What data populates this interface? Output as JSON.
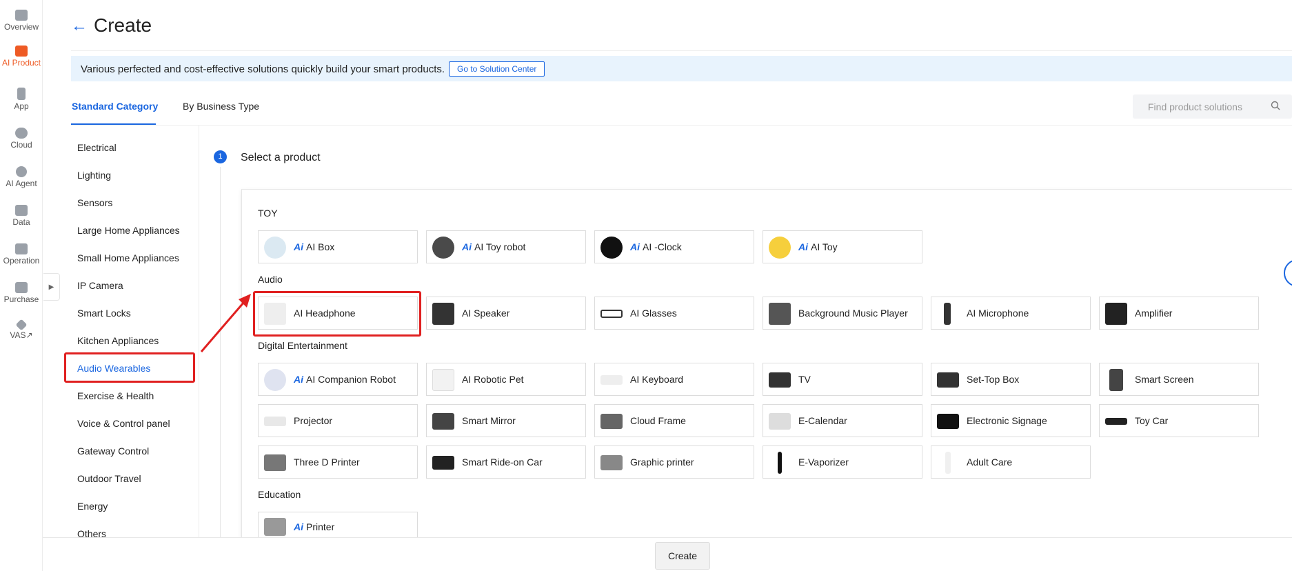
{
  "rail": [
    {
      "label": "Overview"
    },
    {
      "label": "AI Product",
      "active": true
    },
    {
      "label": "App"
    },
    {
      "label": "Cloud"
    },
    {
      "label": "AI Agent"
    },
    {
      "label": "Data"
    },
    {
      "label": "Operation"
    },
    {
      "label": "Purchase"
    },
    {
      "label": "VAS↗"
    }
  ],
  "header": {
    "back_icon": "←",
    "title": "Create"
  },
  "banner": {
    "text": "Various perfected and cost-effective solutions quickly build your smart products.",
    "button": "Go to Solution Center"
  },
  "tabs": [
    {
      "label": "Standard Category",
      "active": true
    },
    {
      "label": "By Business Type"
    }
  ],
  "search": {
    "placeholder": "Find product solutions",
    "icon": "search-icon"
  },
  "categories": [
    "Electrical",
    "Lighting",
    "Sensors",
    "Large Home Appliances",
    "Small Home Appliances",
    "IP Camera",
    "Smart Locks",
    "Kitchen Appliances",
    "Audio Wearables",
    "Exercise & Health",
    "Voice & Control panel",
    "Gateway Control",
    "Outdoor Travel",
    "Energy",
    "Others"
  ],
  "active_category": "Audio Wearables",
  "step": {
    "number": "1",
    "title": "Select a product"
  },
  "sections": {
    "toy": {
      "label": "TOY",
      "items": [
        "AI Box",
        "AI Toy robot",
        "AI -Clock",
        "AI Toy"
      ]
    },
    "audio": {
      "label": "Audio",
      "items": [
        "AI Headphone",
        "AI Speaker",
        "AI Glasses",
        "Background Music Player",
        "AI Microphone",
        "Amplifier"
      ]
    },
    "digital": {
      "label": "Digital Entertainment",
      "items": [
        "AI Companion Robot",
        "AI Robotic Pet",
        "AI Keyboard",
        "TV",
        "Set-Top Box",
        "Smart Screen",
        "Projector",
        "Smart Mirror",
        "Cloud Frame",
        "E-Calendar",
        "Electronic Signage",
        "Toy Car",
        "Three D Printer",
        "Smart Ride-on Car",
        "Graphic printer",
        "E-Vaporizer",
        "Adult Care"
      ]
    },
    "education": {
      "label": "Education",
      "items": [
        "Printer"
      ]
    }
  },
  "ai_badge": "Ai",
  "footer": {
    "create": "Create"
  },
  "colors": {
    "accent": "#1a66e0",
    "brand": "#ee5a24",
    "highlight": "#e02020",
    "banner_bg": "#e8f3fd"
  }
}
